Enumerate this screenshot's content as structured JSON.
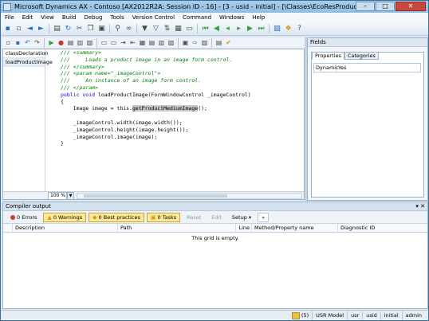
{
  "window": {
    "title": "Microsoft Dynamics AX - Contoso [AX2012R2A: Session ID - 16] - [3 - usid - initial] - [\\Classes\\EcoResProductImageManagement - Ed]",
    "minimize": "–",
    "maximize": "□",
    "close": "✕"
  },
  "menu": [
    "File",
    "Edit",
    "View",
    "Build",
    "Debug",
    "Tools",
    "Version Control",
    "Command",
    "Windows",
    "Help"
  ],
  "editor": {
    "methods": [
      "classDeclaration",
      "loadProductImage"
    ],
    "code_lines": [
      {
        "type": "cm",
        "text": "/// <summary>"
      },
      {
        "type": "cm",
        "text": "///     Loads a product image in an image form control."
      },
      {
        "type": "cm",
        "text": "/// </summary>"
      },
      {
        "type": "cm",
        "text": "/// <param name=\"_imageControl\">"
      },
      {
        "type": "cm",
        "text": "///     An instance of an image form control."
      },
      {
        "type": "cm",
        "text": "/// </param>"
      },
      {
        "type": "sig",
        "kw1": "public void ",
        "rest": "loadProductImage(FormWindowControl _imageControl)"
      },
      {
        "type": "plain",
        "text": "{"
      },
      {
        "type": "hl",
        "pre": "    Image image = this.",
        "hl": "getProductMediumImage",
        "post": "();"
      },
      {
        "type": "plain",
        "text": ""
      },
      {
        "type": "plain",
        "text": "    _imageControl.width(image.width());"
      },
      {
        "type": "plain",
        "text": "    _imageControl.height(image.height());"
      },
      {
        "type": "plain",
        "text": "    _imageControl.image(image);"
      },
      {
        "type": "plain",
        "text": "}"
      }
    ],
    "zoom": "100 %"
  },
  "fields": {
    "title": "Fields",
    "tabs": [
      "Properties",
      "Categories"
    ],
    "property_name": "Dynamic",
    "property_value": "Yes"
  },
  "compiler": {
    "title": "Compiler output",
    "pin": "▾ ✕",
    "errors": "0 Errors",
    "warnings": "0 Warnings",
    "best_practices": "0 Best practices",
    "tasks": "0 Tasks",
    "reset": "Reset",
    "edit": "Edit",
    "setup": "Setup",
    "more": "»",
    "columns": [
      "",
      "Description",
      "Path",
      "Line",
      "Method/Property name",
      "Diagnostic ID"
    ],
    "empty_message": "This grid is empty."
  },
  "status": {
    "count": "(5)",
    "layer": "USR Model",
    "layer2": "usr",
    "user": "usid",
    "state": "initial",
    "role": "admin"
  },
  "colors": {
    "title_bar": "#a9cdeb",
    "close_button": "#c9473c",
    "comment": "#008000",
    "keyword": "#0000ff"
  }
}
